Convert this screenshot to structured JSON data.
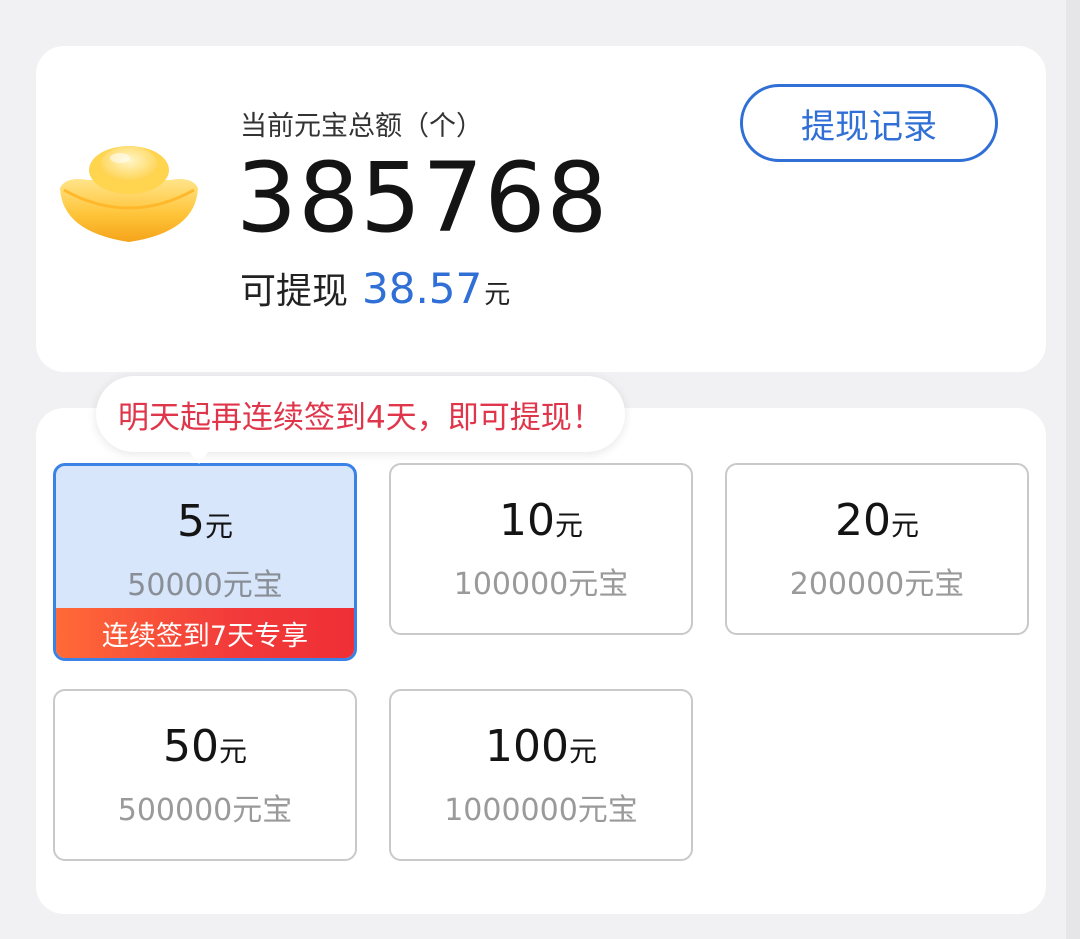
{
  "colors": {
    "accent": "#2f6fd6",
    "tip_text": "#e0364b",
    "selected_bg": "#d7e6fb",
    "badge_red": "#f23a3a"
  },
  "balance": {
    "label": "当前元宝总额（个）",
    "value": "385768",
    "withdrawable_label": "可提现",
    "withdrawable_amount": "38.57",
    "withdrawable_unit": "元",
    "icon": "gold-ingot-icon"
  },
  "record_button": {
    "label": "提现记录"
  },
  "tip": {
    "text": "明天起再连续签到4天，即可提现！"
  },
  "options": [
    {
      "amount": "5",
      "unit": "元",
      "coins": "50000元宝",
      "badge": "连续签到7天专享",
      "selected": true
    },
    {
      "amount": "10",
      "unit": "元",
      "coins": "100000元宝"
    },
    {
      "amount": "20",
      "unit": "元",
      "coins": "200000元宝"
    },
    {
      "amount": "50",
      "unit": "元",
      "coins": "500000元宝"
    },
    {
      "amount": "100",
      "unit": "元",
      "coins": "1000000元宝"
    }
  ]
}
